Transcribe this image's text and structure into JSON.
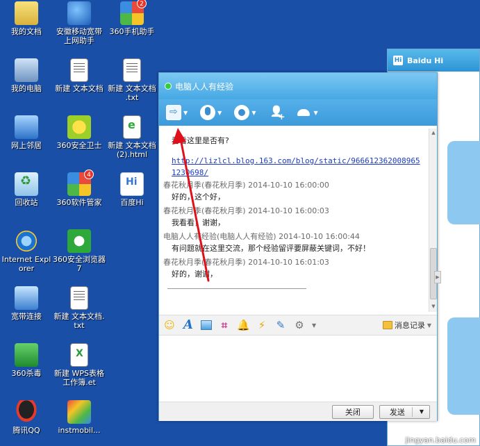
{
  "desktop": {
    "icons": [
      {
        "label": "我的文档"
      },
      {
        "label": "安徽移动宽带上网助手"
      },
      {
        "label": "360手机助手",
        "badge": "2"
      },
      {
        "label": "我的电脑"
      },
      {
        "label": "新建 文本文档"
      },
      {
        "label": "新建 文本文档 .txt"
      },
      {
        "label": "网上邻居"
      },
      {
        "label": "360安全卫士"
      },
      {
        "label": "新建 文本文档 (2).html"
      },
      {
        "label": "回收站"
      },
      {
        "label": "360软件管家",
        "badge": "4"
      },
      {
        "label": "百度Hi"
      },
      {
        "label": "Internet Explorer"
      },
      {
        "label": "360安全浏览器7"
      },
      {
        "label": "宽带连接"
      },
      {
        "label": "新建 文本文档.txt"
      },
      {
        "label": "360杀毒"
      },
      {
        "label": "新建 WPS表格工作簿.et"
      },
      {
        "label": "腾讯QQ"
      },
      {
        "label": "instmobil..."
      }
    ]
  },
  "baidu_hi": {
    "title": "Baidu Hi",
    "logo": "Hi"
  },
  "chat": {
    "title": "电脑人人有经验",
    "messages": [
      {
        "header": "",
        "body": "看看这里是否有?"
      },
      {
        "header": "",
        "link": "http://lizlcl.blog.163.com/blog/static/9666123620089651230698/"
      },
      {
        "header": "春花秋月季(春花秋月季) 2014-10-10 16:00:00",
        "body": "好的，这个好，"
      },
      {
        "header": "春花秋月季(春花秋月季) 2014-10-10 16:00:03",
        "body": "我看看，谢谢，"
      },
      {
        "header": "电脑人人有经验(电脑人人有经验) 2014-10-10 16:00:44",
        "body": "有问题就在这里交流，那个经验留评要屏蔽关键词，不好！"
      },
      {
        "header": "春花秋月季(春花秋月季) 2014-10-10 16:01:03",
        "body": "好的，谢谢，"
      }
    ],
    "history_label": "消息记录",
    "close_label": "关闭",
    "send_label": "发送"
  },
  "watermark": "jingyan.baidu.com",
  "colors": {
    "desktop": "#1a4fa8",
    "title_bar": "#46a8e4",
    "annotation": "#e0101a"
  }
}
